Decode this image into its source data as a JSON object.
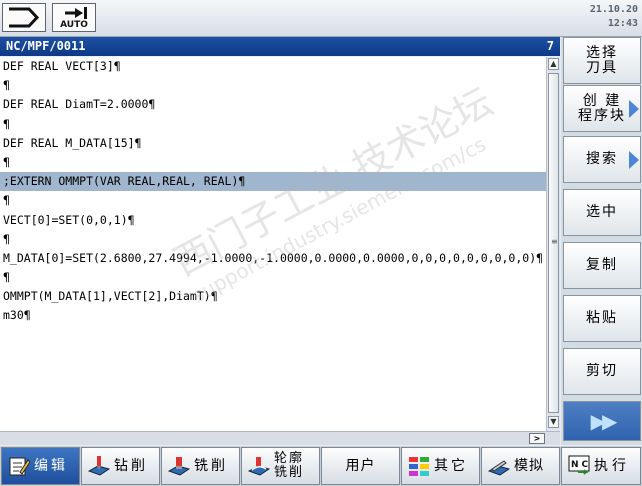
{
  "status": {
    "date": "21.10.20",
    "time": "12:43",
    "mode_label": "AUTO"
  },
  "editor": {
    "path": "NC/MPF/0011",
    "channel": "7",
    "lines": [
      {
        "text": "DEF REAL VECT[3]¶",
        "selected": false
      },
      {
        "text": "¶",
        "selected": false
      },
      {
        "text": "DEF REAL DiamT=2.0000¶",
        "selected": false
      },
      {
        "text": "¶",
        "selected": false
      },
      {
        "text": "DEF REAL M_DATA[15]¶",
        "selected": false
      },
      {
        "text": "¶",
        "selected": false
      },
      {
        "text": ";EXTERN OMMPT(VAR REAL,REAL, REAL)¶",
        "selected": true
      },
      {
        "text": "¶",
        "selected": false
      },
      {
        "text": "VECT[0]=SET(0,0,1)¶",
        "selected": false
      },
      {
        "text": "¶",
        "selected": false
      },
      {
        "text": "M_DATA[0]=SET(2.6800,27.4994,-1.0000,-1.0000,0.0000,0.0000,0,0,0,0,0,0,0,0,0)¶",
        "selected": false
      },
      {
        "text": "¶",
        "selected": false
      },
      {
        "text": "OMMPT(M_DATA[1],VECT[2],DiamT)¶",
        "selected": false
      },
      {
        "text": "m30¶",
        "selected": false
      }
    ]
  },
  "softkeys": {
    "select_tool": "选择\n刀具",
    "create_block": "创 建\n程序块",
    "search": "搜索",
    "select": "选中",
    "copy": "复制",
    "paste": "粘贴",
    "cut": "剪切"
  },
  "hkeys": {
    "edit": "编辑",
    "drill": "钻削",
    "mill": "铣削",
    "contour_mill": "轮廓\n铣削",
    "user": "用户",
    "other": "其它",
    "simulate": "模拟",
    "execute": "执行"
  },
  "watermark": {
    "line1": "西门子工业  技术论坛",
    "line2": "support.industry.siemens.com/cs"
  },
  "colors": {
    "header_blue": "#0e3a86",
    "selection": "#9fb6ce",
    "softkey_arrow": "#4d86d6"
  }
}
